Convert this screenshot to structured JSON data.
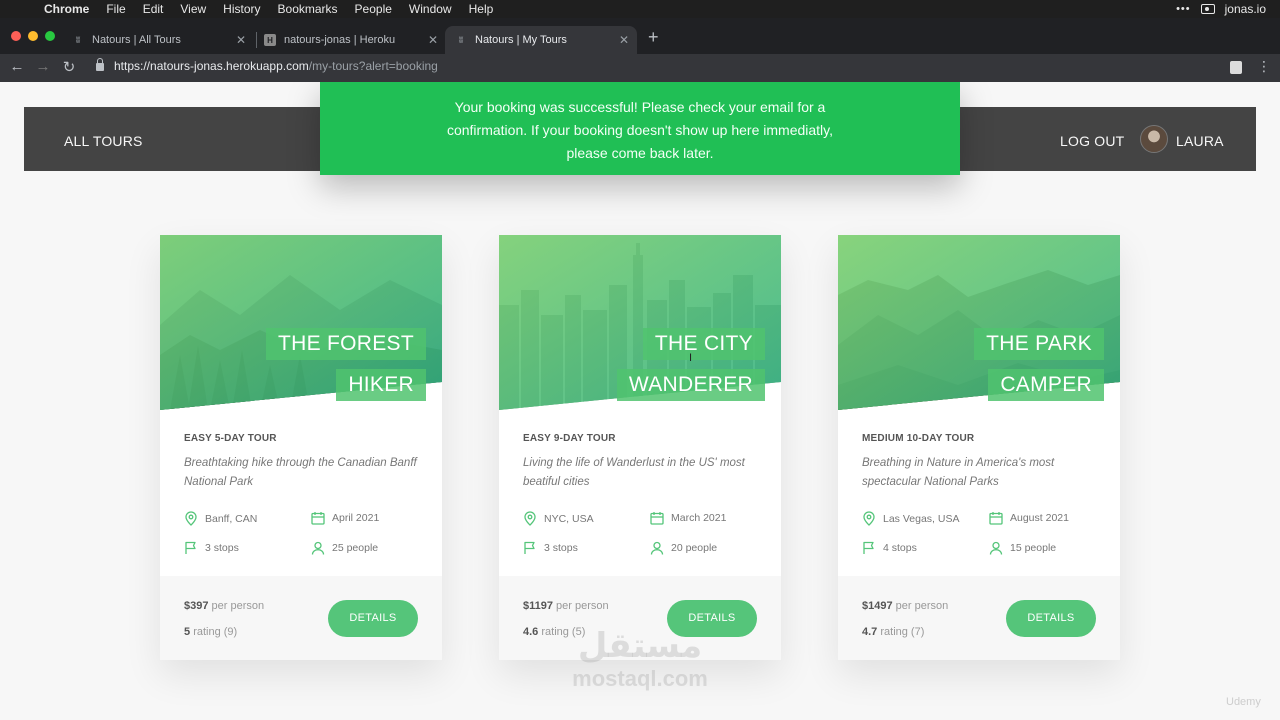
{
  "menubar": {
    "app": "Chrome",
    "items": [
      "File",
      "Edit",
      "View",
      "History",
      "Bookmarks",
      "People",
      "Window",
      "Help"
    ],
    "user": "jonas.io"
  },
  "tabs": [
    {
      "title": "Natours | All Tours",
      "favicon": "natours-icon"
    },
    {
      "title": "natours-jonas | Heroku",
      "favicon": "heroku-icon"
    },
    {
      "title": "Natours | My Tours",
      "favicon": "natours-icon",
      "active": true
    }
  ],
  "url": {
    "host": "https://natours-jonas.herokuapp.com",
    "path": "/my-tours?alert=booking"
  },
  "header": {
    "all_tours": "ALL TOURS",
    "logout": "LOG OUT",
    "user_name": "LAURA"
  },
  "alert": {
    "lines": [
      "Your booking was successful! Please check your email for a",
      "confirmation. If your booking doesn't show up here immediatly,",
      "please come back later."
    ],
    "color": "#20bf55"
  },
  "cards": [
    {
      "title_lines": [
        "THE FOREST",
        "HIKER"
      ],
      "subheading": "EASY 5-DAY TOUR",
      "summary": "Breathtaking hike through the Canadian Banff National Park",
      "location": "Banff, CAN",
      "date": "April 2021",
      "stops": "3 stops",
      "people": "25 people",
      "price": "$397",
      "price_suffix": "per person",
      "rating": "5",
      "rating_count": "rating (9)",
      "button": "DETAILS"
    },
    {
      "title_lines": [
        "THE CITY",
        "WANDERER"
      ],
      "subheading": "EASY 9-DAY TOUR",
      "summary": "Living the life of Wanderlust in the US' most beatiful cities",
      "location": "NYC, USA",
      "date": "March 2021",
      "stops": "3 stops",
      "people": "20 people",
      "price": "$1197",
      "price_suffix": "per person",
      "rating": "4.6",
      "rating_count": "rating (5)",
      "button": "DETAILS"
    },
    {
      "title_lines": [
        "THE PARK",
        "CAMPER"
      ],
      "subheading": "MEDIUM 10-DAY TOUR",
      "summary": "Breathing in Nature in America's most spectacular National Parks",
      "location": "Las Vegas, USA",
      "date": "August 2021",
      "stops": "4 stops",
      "people": "15 people",
      "price": "$1497",
      "price_suffix": "per person",
      "rating": "4.7",
      "rating_count": "rating (7)",
      "button": "DETAILS"
    }
  ],
  "watermark": {
    "arabic": "مستقل",
    "latin": "mostaql.com"
  },
  "udemy": "Udemy",
  "colors": {
    "brand_green": "#55c57a",
    "header_bg": "#444444"
  }
}
